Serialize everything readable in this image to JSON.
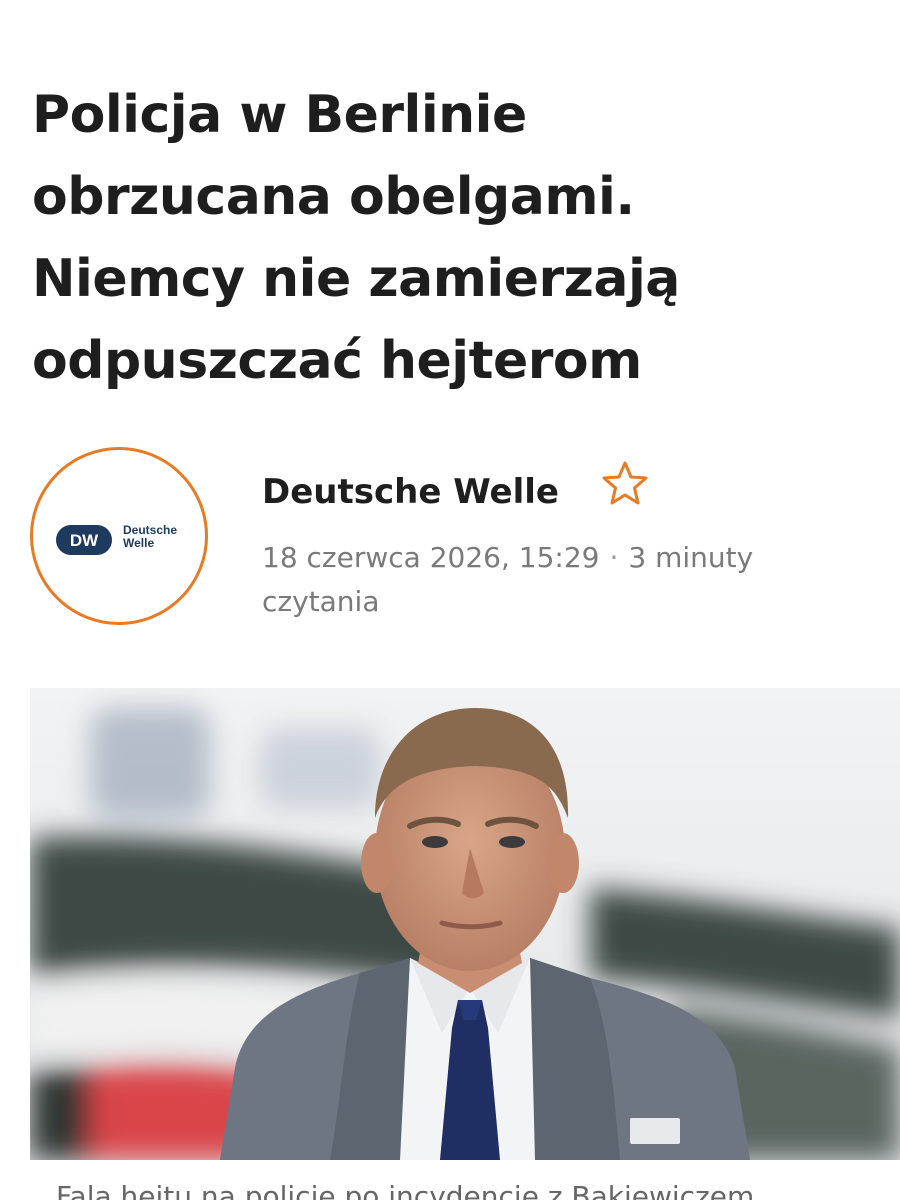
{
  "article": {
    "headline": "Policja w Berlinie\nobrzucana obelgami.\nNiemcy nie zamierzają\nodpuszczać hejterom",
    "author": {
      "name": "Deutsche Welle",
      "logo_mark": "DW",
      "logo_text": "Deutsche\nWelle",
      "follow_icon": "star-outline-icon"
    },
    "date": "18 czerwca 2026, 15:29",
    "separator": "·",
    "read_time": "3 minuty czytania",
    "hero_image": {
      "caption": "Fala hejtu na policję po incydencie z Bąkiewiczem"
    }
  },
  "colors": {
    "accent": "#e87a24",
    "dw_blue": "#1e3a5f",
    "headline": "#1e1e1e",
    "meta": "#7a7a7a"
  }
}
